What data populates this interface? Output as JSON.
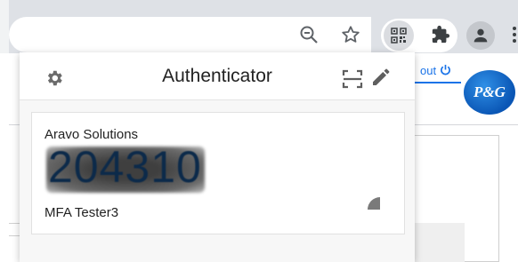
{
  "browser": {
    "toolbar_icons": [
      "zoom-icon",
      "star-icon",
      "authenticator-extension-icon",
      "puzzle-icon",
      "profile-icon",
      "menu-dots-icon"
    ]
  },
  "page": {
    "logout_text": "out",
    "logout_icon": "power-icon",
    "logo_text": "P&G"
  },
  "popup": {
    "title": "Authenticator",
    "icons": [
      "gear-icon",
      "scan-qr-icon",
      "pencil-icon"
    ],
    "accounts": [
      {
        "issuer": "Aravo Solutions",
        "code": "204310",
        "name": "MFA Tester3",
        "timer_icon": "pie-timer-icon"
      }
    ]
  },
  "colors": {
    "link_blue": "#1a73e8",
    "toolbar_gray": "#dee1e6",
    "logo_blue": "#0a56b5"
  }
}
